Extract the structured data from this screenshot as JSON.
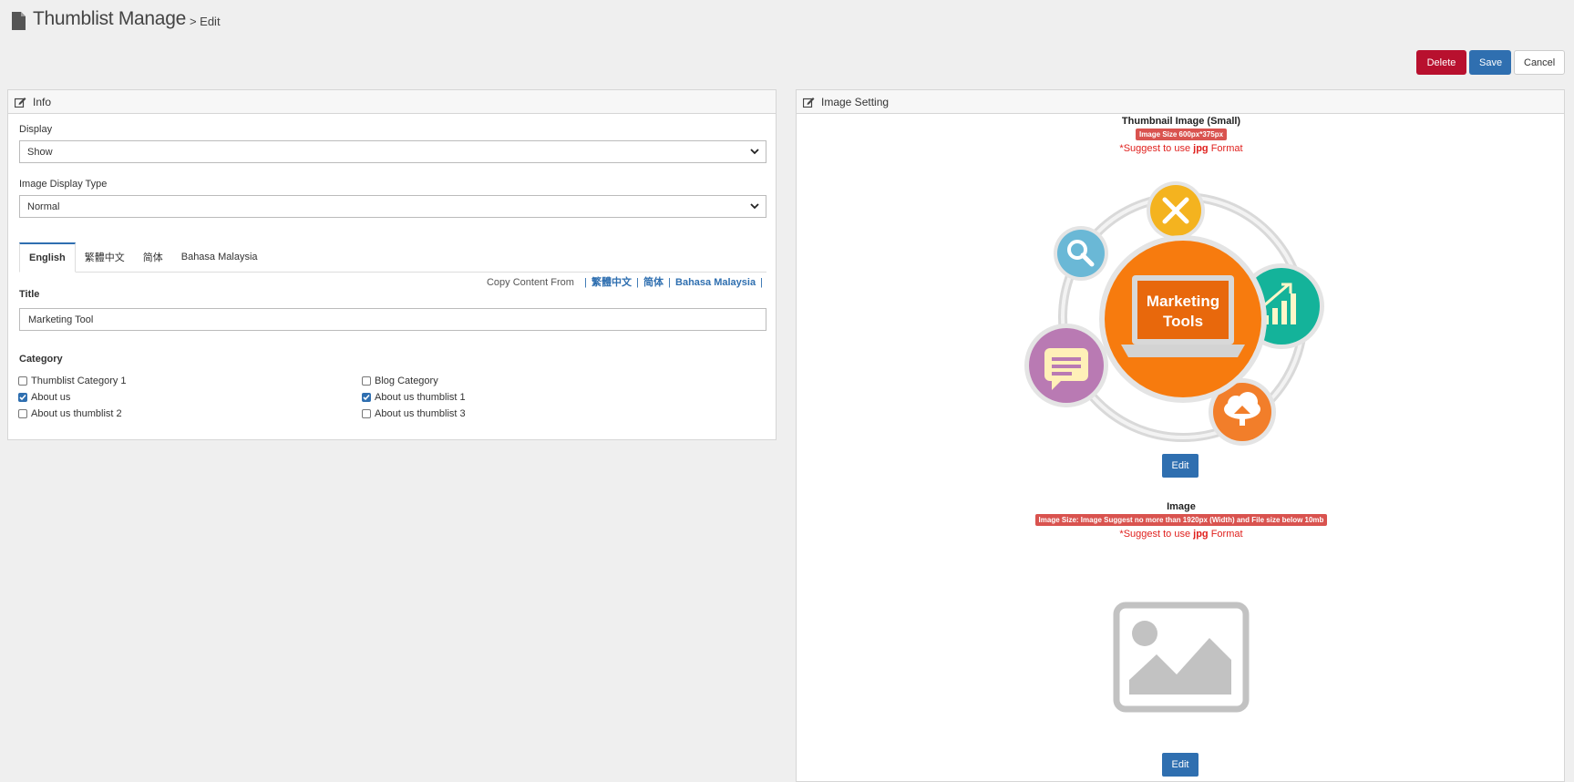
{
  "header": {
    "title": "Thumblist Manage",
    "crumb": "> Edit"
  },
  "actions": {
    "delete": "Delete",
    "save": "Save",
    "cancel": "Cancel"
  },
  "colors": {
    "primary": "#2f6fb0",
    "danger": "#b8102e",
    "badge": "#d9534f",
    "warning_text": "#e0211e"
  },
  "info": {
    "heading": "Info",
    "display_label": "Display",
    "display_value": "Show",
    "image_type_label": "Image Display Type",
    "image_type_value": "Normal",
    "tabs": [
      {
        "label": "English",
        "active": true
      },
      {
        "label": "繁體中文",
        "active": false
      },
      {
        "label": "简体",
        "active": false
      },
      {
        "label": "Bahasa Malaysia",
        "active": false
      }
    ],
    "copy_from": {
      "label": "Copy Content From",
      "sep": "|",
      "links": [
        "繁體中文",
        "简体",
        "Bahasa Malaysia"
      ]
    },
    "title_label": "Title",
    "title_value": "Marketing Tool",
    "category_label": "Category",
    "categories": [
      {
        "label": "Thumblist Category 1",
        "checked": false
      },
      {
        "label": "Blog Category",
        "checked": false
      },
      {
        "label": "About us",
        "checked": true
      },
      {
        "label": "About us thumblist 1",
        "checked": true
      },
      {
        "label": "About us thumblist 2",
        "checked": false
      },
      {
        "label": "About us thumblist 3",
        "checked": false
      }
    ]
  },
  "image_setting": {
    "heading": "Image Setting",
    "thumbnail": {
      "title": "Thumbnail Image (Small)",
      "size_badge": "Image Size 600px*375px",
      "suggest_pre": "*Suggest to use ",
      "suggest_fmt": "jpg",
      "suggest_post": " Format",
      "image_text_1": "Marketing",
      "image_text_2": "Tools",
      "edit": "Edit"
    },
    "image": {
      "title": "Image",
      "size_badge": "Image Size: Image Suggest no more than 1920px (Width) and File size below 10mb",
      "suggest_pre": "*Suggest to use ",
      "suggest_fmt": "jpg",
      "suggest_post": " Format",
      "edit": "Edit"
    }
  }
}
